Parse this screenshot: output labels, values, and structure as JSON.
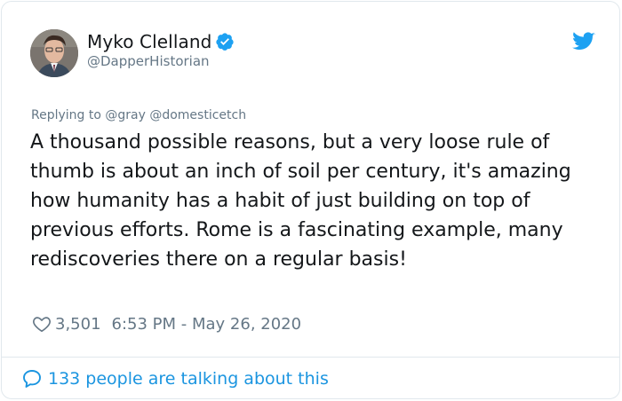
{
  "author": {
    "display_name": "Myko Clelland",
    "handle": "@DapperHistorian",
    "verified": true
  },
  "reply": {
    "label": "Replying to @gray @domesticetch"
  },
  "tweet": {
    "text": "A thousand possible reasons, but a very loose rule of thumb is about an inch of soil per century, it's amazing how humanity has a habit of just building on top of previous efforts. Rome is a fascinating example, many rediscoveries there on a regular basis!"
  },
  "meta": {
    "likes": "3,501",
    "timestamp": "6:53 PM - May 26, 2020"
  },
  "footer": {
    "talking_text": "133 people are talking about this"
  },
  "icons": {
    "verified": "verified-badge-icon",
    "twitter": "twitter-bird-icon",
    "like": "heart-icon",
    "comments": "speech-bubble-icon"
  },
  "colors": {
    "accent": "#1da1f2",
    "link": "#1b95e0",
    "muted": "#657786",
    "text": "#14171a",
    "border": "#e1e8ed"
  }
}
